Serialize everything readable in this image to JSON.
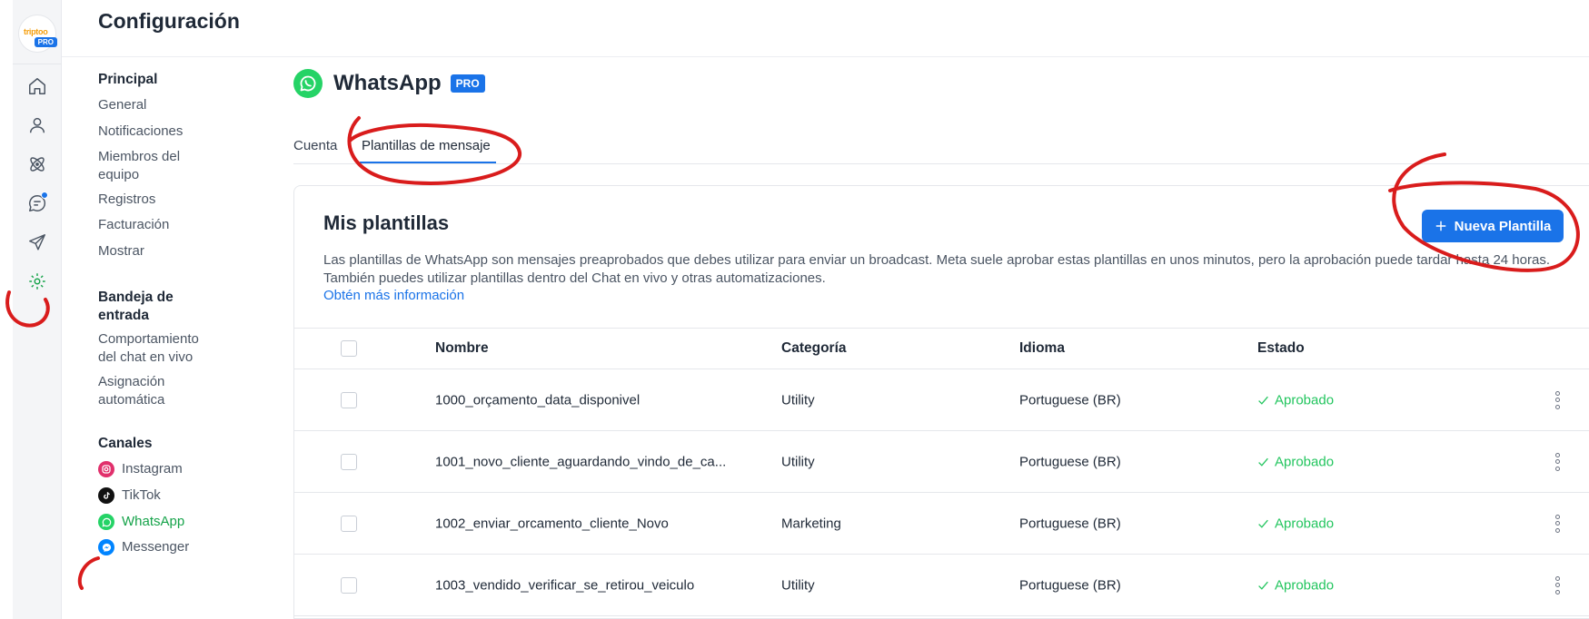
{
  "app": {
    "logo_text": "triptoo",
    "logo_badge": "PRO",
    "page_title": "Configuración"
  },
  "iconbar": [
    {
      "name": "home-icon"
    },
    {
      "name": "user-icon"
    },
    {
      "name": "atom-icon"
    },
    {
      "name": "chat-icon"
    },
    {
      "name": "send-icon"
    },
    {
      "name": "settings-icon"
    }
  ],
  "settings_nav": {
    "principal": {
      "title": "Principal",
      "items": [
        "General",
        "Notificaciones",
        "Miembros del equipo",
        "Registros",
        "Facturación",
        "Mostrar"
      ]
    },
    "inbox": {
      "title": "Bandeja de entrada",
      "items": [
        "Comportamiento del chat en vivo",
        "Asignación automática"
      ]
    },
    "channels": {
      "title": "Canales",
      "items": [
        "Instagram",
        "TikTok",
        "WhatsApp",
        "Messenger"
      ]
    }
  },
  "main": {
    "title": "WhatsApp",
    "badge": "PRO",
    "tabs": [
      "Cuenta",
      "Plantillas de mensaje"
    ],
    "active_tab": "Plantillas de mensaje"
  },
  "card": {
    "title": "Mis plantillas",
    "new_button": "Nueva Plantilla",
    "description": "Las plantillas de WhatsApp son mensajes preaprobados que debes utilizar para enviar un broadcast. Meta suele aprobar estas plantillas en unos minutos, pero la aprobación puede tardar hasta 24 horas. También puedes utilizar plantillas dentro del Chat en vivo y otras automatizaciones.",
    "link": "Obtén más información"
  },
  "table": {
    "headers": [
      "Nombre",
      "Categoría",
      "Idioma",
      "Estado"
    ],
    "rows": [
      {
        "name": "1000_orçamento_data_disponivel",
        "category": "Utility",
        "language": "Portuguese (BR)",
        "status": "Aprobado"
      },
      {
        "name": "1001_novo_cliente_aguardando_vindo_de_ca...",
        "category": "Utility",
        "language": "Portuguese (BR)",
        "status": "Aprobado"
      },
      {
        "name": "1002_enviar_orcamento_cliente_Novo",
        "category": "Marketing",
        "language": "Portuguese (BR)",
        "status": "Aprobado"
      },
      {
        "name": "1003_vendido_verificar_se_retirou_veiculo",
        "category": "Utility",
        "language": "Portuguese (BR)",
        "status": "Aprobado"
      }
    ]
  },
  "colors": {
    "accent": "#1a73e8",
    "whatsapp": "#25d366",
    "success": "#22c55e",
    "annotation": "#d91c1c"
  }
}
